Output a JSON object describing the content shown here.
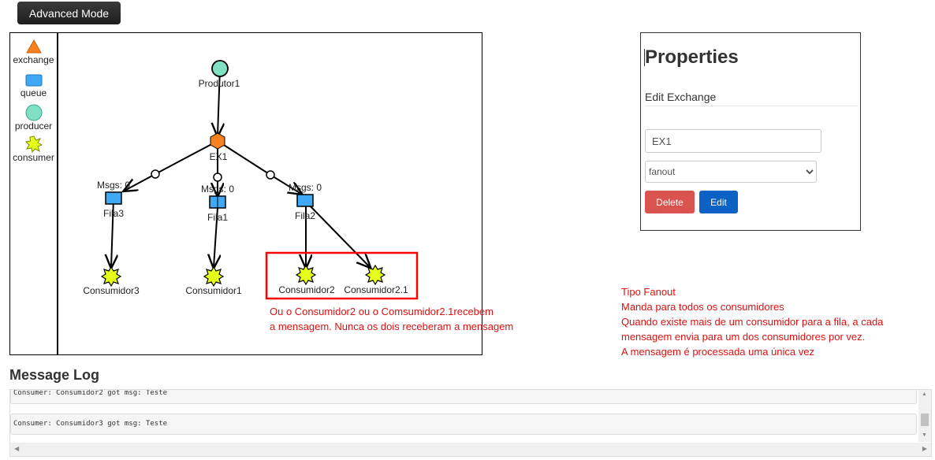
{
  "toolbar": {
    "advanced_mode_label": "Advanced Mode"
  },
  "palette": {
    "items": [
      {
        "label": "exchange",
        "icon": "triangle-icon",
        "color": "#f5821f"
      },
      {
        "label": "queue",
        "icon": "rect-icon",
        "color": "#3fa9f5"
      },
      {
        "label": "producer",
        "icon": "circle-icon",
        "color": "#7fe0c4"
      },
      {
        "label": "consumer",
        "icon": "star-icon",
        "color": "#e5ff1a"
      }
    ]
  },
  "graph": {
    "producer": {
      "label": "Produtor1"
    },
    "exchange": {
      "label": "EX1"
    },
    "queues": [
      {
        "label": "Fila3",
        "msgs": "Msgs: 0"
      },
      {
        "label": "Fila1",
        "msgs": "Msgs: 0"
      },
      {
        "label": "Fila2",
        "msgs": "Msgs: 0"
      }
    ],
    "consumers": [
      {
        "label": "Consumidor3"
      },
      {
        "label": "Consumidor1"
      },
      {
        "label": "Consumidor2"
      },
      {
        "label": "Consumidor2.1"
      }
    ]
  },
  "annotation_left": {
    "line1": "Ou o Consumidor2 ou o Comsumidor2.1recebem",
    "line2": "a mensagem. Nunca os dois receberam a mensagem"
  },
  "annotation_right": {
    "line1": "Tipo Fanout",
    "line2": "Manda para todos os consumidores",
    "line3": "Quando existe mais de um consumidor para a fila, a cada",
    "line4": "mensagem envia para um dos consumidores por vez.",
    "line5": "A mensagem é processada uma única vez"
  },
  "properties": {
    "title": "Properties",
    "subtitle": "Edit Exchange",
    "name_value": "EX1",
    "type_value": "fanout",
    "delete_label": "Delete",
    "edit_label": "Edit"
  },
  "log": {
    "title": "Message Log",
    "entries": [
      "Consumer: Consumidor2 got msg:  Teste",
      "Consumer: Consumidor3 got msg:  Teste"
    ]
  },
  "colors": {
    "exchange": "#f5821f",
    "queue": "#3fa9f5",
    "producer": "#7fe0c4",
    "consumer": "#e5ff1a",
    "annotation": "#dd1111",
    "highlight_box": "#ff0000",
    "delete": "#d9534f",
    "edit": "#0b62c4"
  }
}
